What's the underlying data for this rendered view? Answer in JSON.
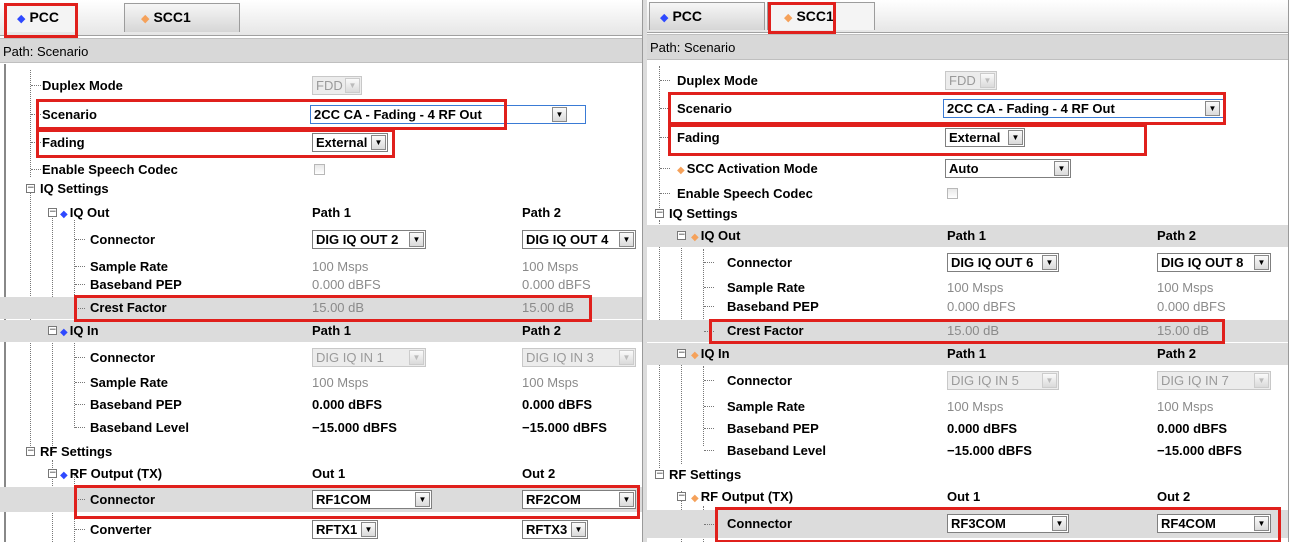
{
  "left": {
    "tabs": [
      {
        "label": "PCC",
        "dot": "blue"
      },
      {
        "label": "SCC1",
        "dot": "orange"
      }
    ],
    "path_label": "Path:",
    "path_value": "Scenario",
    "duplex_mode": {
      "label": "Duplex Mode",
      "value": "FDD"
    },
    "scenario": {
      "label": "Scenario",
      "value": "2CC CA - Fading - 4 RF Out"
    },
    "fading": {
      "label": "Fading",
      "value": "External"
    },
    "speech_codec": {
      "label": "Enable Speech Codec"
    },
    "iq_settings": {
      "label": "IQ Settings"
    },
    "iq_out": {
      "label": "IQ Out",
      "col1": "Path 1",
      "col2": "Path 2",
      "connector": {
        "label": "Connector",
        "v1": "DIG IQ OUT 2",
        "v2": "DIG IQ OUT 4"
      },
      "sample_rate": {
        "label": "Sample Rate",
        "v1": "100 Msps",
        "v2": "100 Msps"
      },
      "baseband_pep": {
        "label": "Baseband PEP",
        "v1": "0.000 dBFS",
        "v2": "0.000 dBFS"
      },
      "crest_factor": {
        "label": "Crest Factor",
        "v1": "15.00 dB",
        "v2": "15.00 dB"
      }
    },
    "iq_in": {
      "label": "IQ In",
      "col1": "Path 1",
      "col2": "Path 2",
      "connector": {
        "label": "Connector",
        "v1": "DIG IQ IN 1",
        "v2": "DIG IQ IN 3"
      },
      "sample_rate": {
        "label": "Sample Rate",
        "v1": "100 Msps",
        "v2": "100 Msps"
      },
      "baseband_pep": {
        "label": "Baseband PEP",
        "v1": "0.000 dBFS",
        "v2": "0.000 dBFS"
      },
      "baseband_level": {
        "label": "Baseband Level",
        "v1": "−15.000 dBFS",
        "v2": "−15.000 dBFS"
      }
    },
    "rf_settings": {
      "label": "RF Settings"
    },
    "rf_output": {
      "label": "RF Output (TX)",
      "col1": "Out 1",
      "col2": "Out 2",
      "connector": {
        "label": "Connector",
        "v1": "RF1COM",
        "v2": "RF2COM"
      },
      "converter": {
        "label": "Converter",
        "v1": "RFTX1",
        "v2": "RFTX3"
      }
    }
  },
  "right": {
    "tabs": [
      {
        "label": "PCC",
        "dot": "blue"
      },
      {
        "label": "SCC1",
        "dot": "orange"
      }
    ],
    "path_label": "Path:",
    "path_value": "Scenario",
    "duplex_mode": {
      "label": "Duplex Mode",
      "value": "FDD"
    },
    "scenario": {
      "label": "Scenario",
      "value": "2CC CA - Fading - 4 RF Out"
    },
    "fading": {
      "label": "Fading",
      "value": "External"
    },
    "scc_activation": {
      "label": "SCC Activation Mode",
      "value": "Auto"
    },
    "speech_codec": {
      "label": "Enable Speech Codec"
    },
    "iq_settings": {
      "label": "IQ Settings"
    },
    "iq_out": {
      "label": "IQ Out",
      "col1": "Path 1",
      "col2": "Path 2",
      "connector": {
        "label": "Connector",
        "v1": "DIG IQ OUT 6",
        "v2": "DIG IQ OUT 8"
      },
      "sample_rate": {
        "label": "Sample Rate",
        "v1": "100 Msps",
        "v2": "100 Msps"
      },
      "baseband_pep": {
        "label": "Baseband PEP",
        "v1": "0.000 dBFS",
        "v2": "0.000 dBFS"
      },
      "crest_factor": {
        "label": "Crest Factor",
        "v1": "15.00 dB",
        "v2": "15.00 dB"
      }
    },
    "iq_in": {
      "label": "IQ In",
      "col1": "Path 1",
      "col2": "Path 2",
      "connector": {
        "label": "Connector",
        "v1": "DIG IQ IN 5",
        "v2": "DIG IQ IN 7"
      },
      "sample_rate": {
        "label": "Sample Rate",
        "v1": "100 Msps",
        "v2": "100 Msps"
      },
      "baseband_pep": {
        "label": "Baseband PEP",
        "v1": "0.000 dBFS",
        "v2": "0.000 dBFS"
      },
      "baseband_level": {
        "label": "Baseband Level",
        "v1": "−15.000 dBFS",
        "v2": "−15.000 dBFS"
      }
    },
    "rf_settings": {
      "label": "RF Settings"
    },
    "rf_output": {
      "label": "RF Output (TX)",
      "col1": "Out 1",
      "col2": "Out 2",
      "connector": {
        "label": "Connector",
        "v1": "RF3COM",
        "v2": "RF4COM"
      }
    }
  },
  "colors": {
    "highlight": "#e0201c",
    "pcc_dot": "#2e49ff",
    "scc_dot": "#f5a15a",
    "row_shade": "#dcdcdc"
  },
  "icons": [
    "blue-diamond-icon",
    "orange-diamond-icon",
    "tree-expander-icon",
    "dropdown-arrow-icon"
  ]
}
